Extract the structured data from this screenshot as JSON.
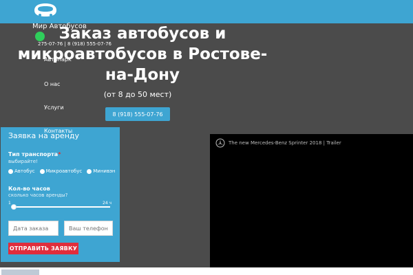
{
  "header": {
    "brand": "Мир Автобусов",
    "phones": "275-07-76 | 8 (918) 555-07-76",
    "logo_icon": "bus-logo-icon"
  },
  "nav": {
    "items": [
      "Автопарк",
      "О нас",
      "Услуги",
      "Контакты"
    ]
  },
  "hero": {
    "title": "Заказ автобусов и микроавтобусов в Ростове-на-Дону",
    "subtitle": "(от 8 до 50 мест)",
    "phone_button": "8 (918) 555-07-76"
  },
  "form": {
    "title": "Заявка на аренду",
    "transport_label": "Тип транспорта",
    "transport_hint": "выбирайте!",
    "transport_options": [
      "Автобус",
      "Микроавтобус",
      "Минивэн"
    ],
    "hours_label": "Кол-во часов",
    "hours_hint": "сколько часов аренды?",
    "slider_min": "1",
    "slider_max": "24 ч",
    "slider_value_fraction": 0.0,
    "order_date_placeholder": "Дата заказа",
    "phone_placeholder": "Ваш телефон",
    "submit_label": "ОТПРАВИТЬ ЗАЯВКУ"
  },
  "video": {
    "title": "The new Mercedes-Benz Sprinter 2018 | Trailer",
    "icon": "mercedes-logo-icon"
  },
  "colors": {
    "accent": "#3ea5d2",
    "submit": "#e02d3c",
    "status_dot": "#2fce5b",
    "background": "#4b4b4b"
  }
}
